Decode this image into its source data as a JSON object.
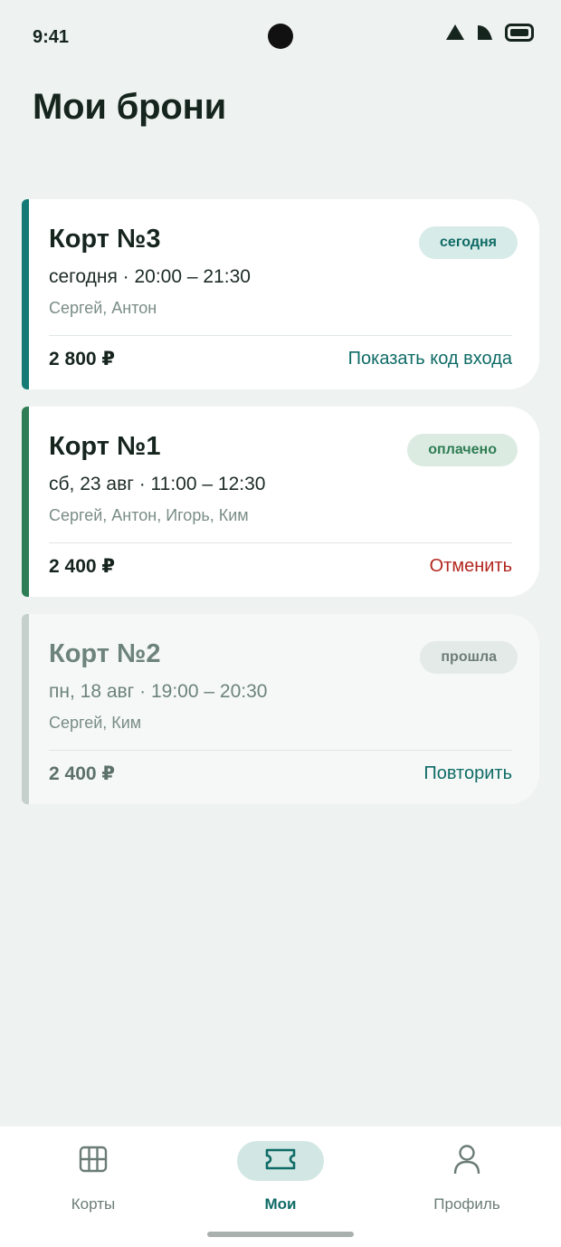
{
  "status_bar": {
    "time": "9:41"
  },
  "page": {
    "title": "Мои брони"
  },
  "colors": {
    "today_accent": "#157a75",
    "paid_accent": "#2f7d54",
    "past_accent": "#c5d0cc",
    "cancel_red": "#b3261e",
    "primary_teal": "#0f6b66"
  },
  "bookings": [
    {
      "court": "Корт №3",
      "badge": "сегодня",
      "when": "сегодня · 20:00 – 21:30",
      "players": "Сергей, Антон",
      "price": "2 800 ₽",
      "action": "Показать код входа"
    },
    {
      "court": "Корт №1",
      "badge": "оплачено",
      "when": "сб, 23 авг · 11:00 – 12:30",
      "players": "Сергей, Антон, Игорь, Ким",
      "price": "2 400 ₽",
      "action": "Отменить"
    },
    {
      "court": "Корт №2",
      "badge": "прошла",
      "when": "пн, 18 авг · 19:00 – 20:30",
      "players": "Сергей, Ким",
      "price": "2 400 ₽",
      "action": "Повторить"
    }
  ],
  "nav": {
    "items": [
      {
        "label": "Корты",
        "icon": "grid-icon"
      },
      {
        "label": "Мои",
        "icon": "ticket-icon",
        "active": true
      },
      {
        "label": "Профиль",
        "icon": "person-icon"
      }
    ]
  }
}
